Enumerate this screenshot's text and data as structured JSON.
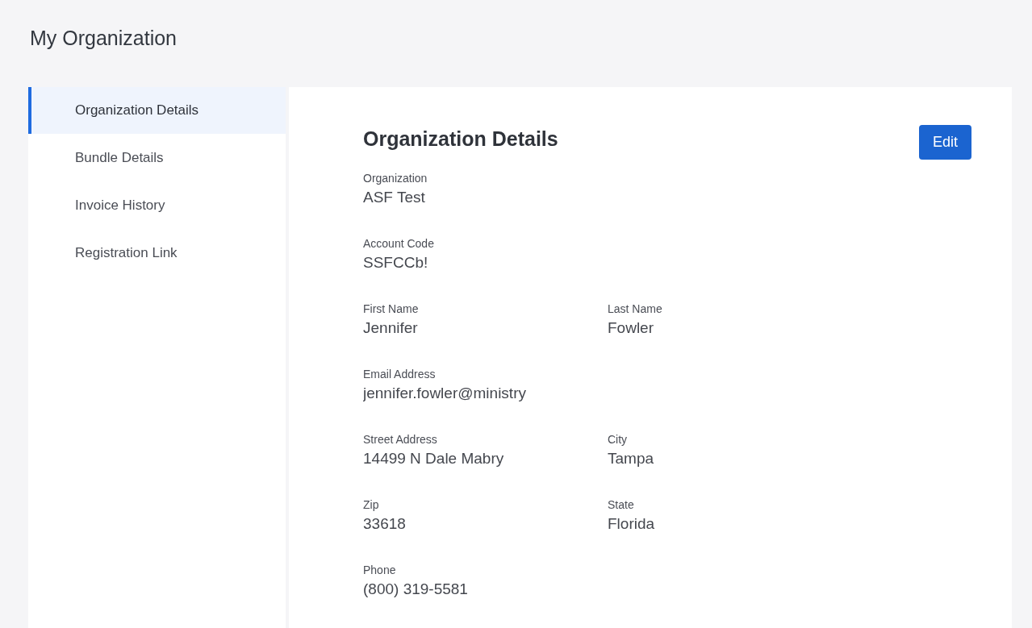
{
  "page_title": "My Organization",
  "sidebar": {
    "items": [
      {
        "label": "Organization Details",
        "selected": true
      },
      {
        "label": "Bundle Details",
        "selected": false
      },
      {
        "label": "Invoice History",
        "selected": false
      },
      {
        "label": "Registration Link",
        "selected": false
      }
    ]
  },
  "details": {
    "heading": "Organization Details",
    "edit_button": "Edit",
    "rows": [
      [
        {
          "label": "Organization",
          "value": "ASF Test"
        }
      ],
      [
        {
          "label": "Account Code",
          "value": "SSFCCb!"
        }
      ],
      [
        {
          "label": "First Name",
          "value": "Jennifer"
        },
        {
          "label": "Last Name",
          "value": "Fowler"
        }
      ],
      [
        {
          "label": "Email Address",
          "value": "jennifer.fowler@ministry"
        }
      ],
      [
        {
          "label": "Street Address",
          "value": "14499 N Dale Mabry"
        },
        {
          "label": "City",
          "value": "Tampa"
        }
      ],
      [
        {
          "label": "Zip",
          "value": "33618"
        },
        {
          "label": "State",
          "value": "Florida"
        }
      ],
      [
        {
          "label": "Phone",
          "value": "(800) 319-5581"
        }
      ]
    ]
  }
}
